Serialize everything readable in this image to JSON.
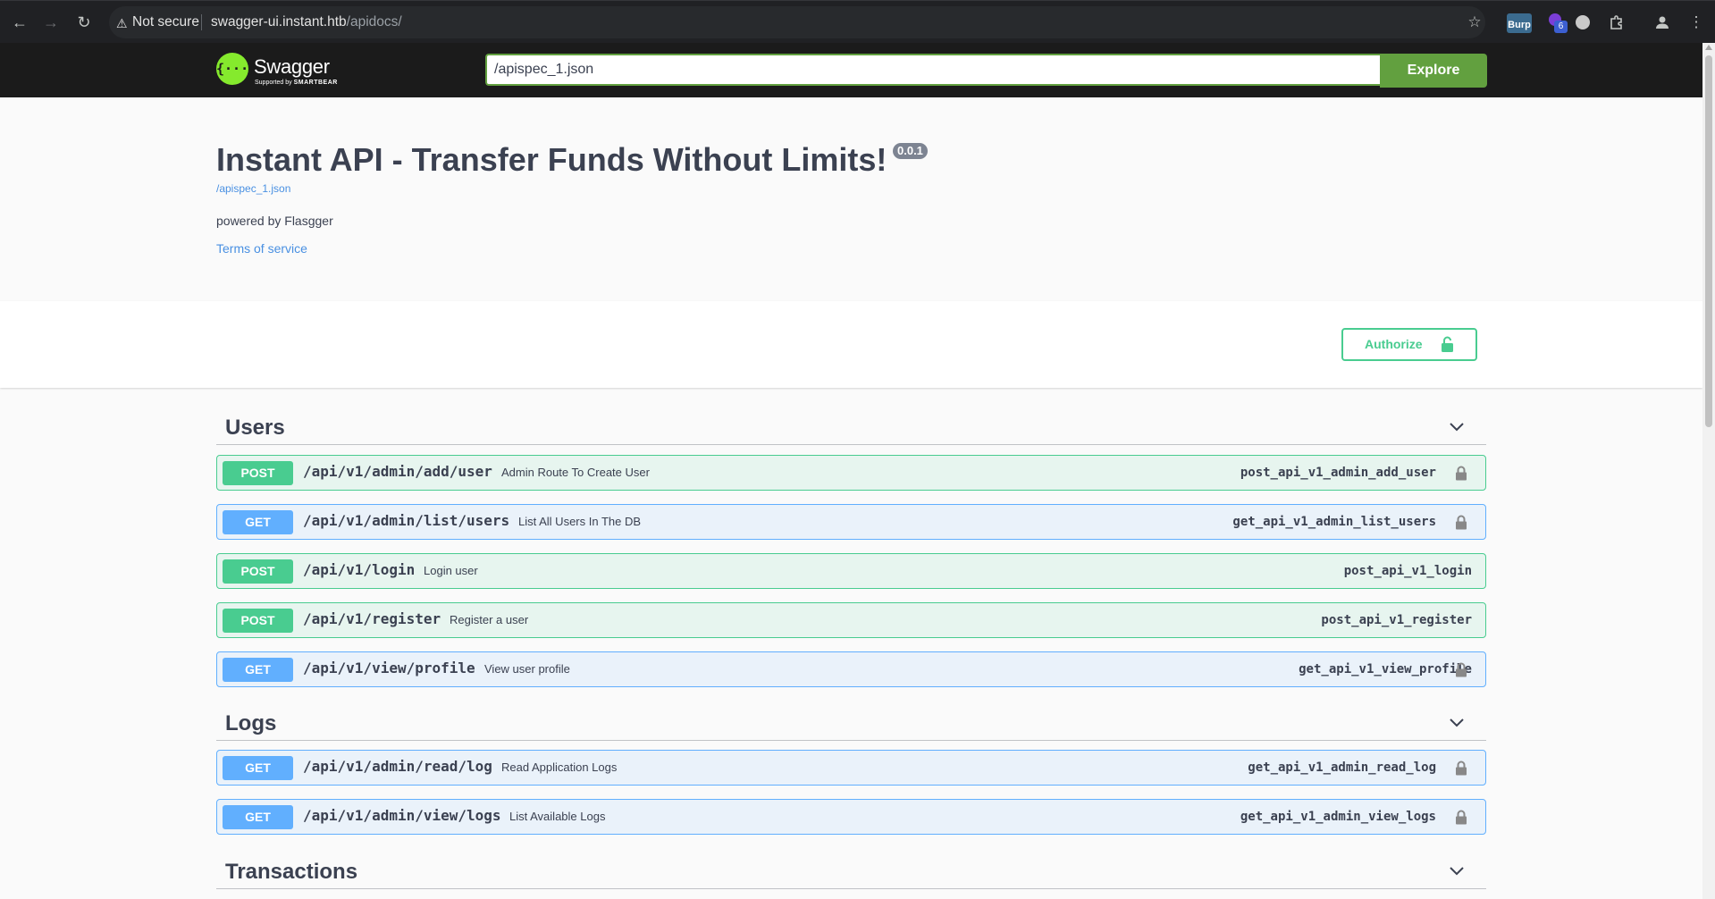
{
  "browser": {
    "security_label": "Not secure",
    "url_host": "swagger-ui.instant.htb",
    "url_path": "/apidocs/",
    "extension_burp_label": "Burp",
    "extension_badge_count": "6"
  },
  "topbar": {
    "logo_text": "Swagger",
    "logo_subtext": "Supported by",
    "logo_brand": "SMARTBEAR",
    "spec_url_value": "/apispec_1.json",
    "explore_label": "Explore"
  },
  "info": {
    "title": "Instant API - Transfer Funds Without Limits!",
    "version": "0.0.1",
    "spec_link": "/apispec_1.json",
    "description": "powered by Flasgger",
    "terms_label": "Terms of service"
  },
  "authorize_label": "Authorize",
  "tags": [
    {
      "name": "Users",
      "operations": [
        {
          "method": "POST",
          "path": "/api/v1/admin/add/user",
          "summary": "Admin Route To Create User",
          "operation_id": "post_api_v1_admin_add_user",
          "locked": true
        },
        {
          "method": "GET",
          "path": "/api/v1/admin/list/users",
          "summary": "List All Users In The DB",
          "operation_id": "get_api_v1_admin_list_users",
          "locked": true
        },
        {
          "method": "POST",
          "path": "/api/v1/login",
          "summary": "Login user",
          "operation_id": "post_api_v1_login",
          "locked": false
        },
        {
          "method": "POST",
          "path": "/api/v1/register",
          "summary": "Register a user",
          "operation_id": "post_api_v1_register",
          "locked": false
        },
        {
          "method": "GET",
          "path": "/api/v1/view/profile",
          "summary": "View user profile",
          "operation_id": "get_api_v1_view_profile",
          "locked": true
        }
      ]
    },
    {
      "name": "Logs",
      "operations": [
        {
          "method": "GET",
          "path": "/api/v1/admin/read/log",
          "summary": "Read Application Logs",
          "operation_id": "get_api_v1_admin_read_log",
          "locked": true
        },
        {
          "method": "GET",
          "path": "/api/v1/admin/view/logs",
          "summary": "List Available Logs",
          "operation_id": "get_api_v1_admin_view_logs",
          "locked": true
        }
      ]
    },
    {
      "name": "Transactions",
      "operations": []
    }
  ],
  "colors": {
    "post": "#49cc90",
    "get": "#61affe",
    "topbar": "#1b1b1b",
    "explore": "#62a03f"
  }
}
